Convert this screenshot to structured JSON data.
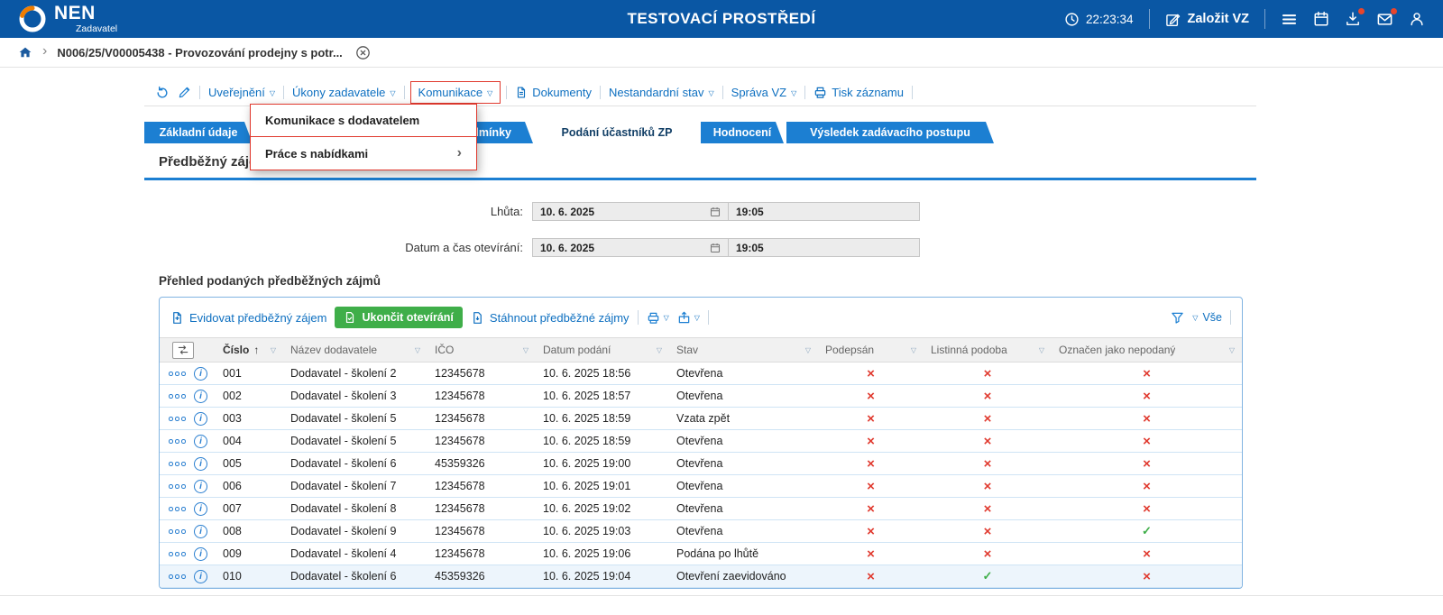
{
  "glyphs": {
    "dropdown": "▽",
    "sort_asc": "↑",
    "chevron": "›",
    "check": "✓",
    "cross": "×",
    "info": "i"
  },
  "colors": {
    "header_blue": "#0a57a4",
    "tab_blue": "#1c7fd2",
    "link_blue": "#0d6fc0",
    "green": "#3fae49",
    "red": "#e0392e",
    "orange": "#f07d00"
  },
  "header": {
    "logo": "NEN",
    "logo_sub": "Zadavatel",
    "title": "TESTOVACÍ PROSTŘEDÍ",
    "time": "22:23:34",
    "create_vz_label": "Založit VZ"
  },
  "breadcrumb": {
    "item": "N006/25/V00005438 - Provozování prodejny s potr..."
  },
  "toolbar": {
    "items": [
      {
        "label": "Uveřejnění"
      },
      {
        "label": "Úkony zadavatele"
      },
      {
        "label": "Komunikace"
      },
      {
        "label": "Dokumenty"
      },
      {
        "label": "Nestandardní stav"
      },
      {
        "label": "Správa VZ"
      },
      {
        "label": "Tisk záznamu"
      }
    ]
  },
  "menu": {
    "items": [
      {
        "label": "Komunikace s dodavatelem"
      },
      {
        "label": "Práce s nabídkami"
      }
    ]
  },
  "tabs": [
    {
      "label": "Základní údaje"
    },
    {
      "label": "Zadávací podmínky"
    },
    {
      "label": "Podání účastníků ZP"
    },
    {
      "label": "Hodnocení"
    },
    {
      "label": "Výsledek zadávacího postupu"
    }
  ],
  "section": {
    "title": "Předběžný zájem",
    "fields": [
      {
        "label": "Lhůta:",
        "date": "10. 6. 2025",
        "time": "19:05"
      },
      {
        "label": "Datum a čas otevírání:",
        "date": "10. 6. 2025",
        "time": "19:05"
      }
    ]
  },
  "table": {
    "title": "Přehled podaných předběžných zájmů",
    "sort_indicator": "↑",
    "toolbar": {
      "evidovat": "Evidovat předběžný zájem",
      "ukoncit": "Ukončit otevírání",
      "stahnout": "Stáhnout předběžné zájmy",
      "vse": "Vše"
    },
    "columns": [
      "Číslo",
      "Název dodavatele",
      "IČO",
      "Datum podání",
      "Stav",
      "Podepsán",
      "Listinná podoba",
      "Označen jako nepodaný"
    ],
    "rows": [
      {
        "cislo": "001",
        "nazev": "Dodavatel - školení 2",
        "ico": "12345678",
        "datum": "10. 6. 2025 18:56",
        "stav": "Otevřena",
        "podepsan": false,
        "listinna": false,
        "nepodany": false
      },
      {
        "cislo": "002",
        "nazev": "Dodavatel - školení 3",
        "ico": "12345678",
        "datum": "10. 6. 2025 18:57",
        "stav": "Otevřena",
        "podepsan": false,
        "listinna": false,
        "nepodany": false
      },
      {
        "cislo": "003",
        "nazev": "Dodavatel - školení 5",
        "ico": "12345678",
        "datum": "10. 6. 2025 18:59",
        "stav": "Vzata zpět",
        "podepsan": false,
        "listinna": false,
        "nepodany": false
      },
      {
        "cislo": "004",
        "nazev": "Dodavatel - školení 5",
        "ico": "12345678",
        "datum": "10. 6. 2025 18:59",
        "stav": "Otevřena",
        "podepsan": false,
        "listinna": false,
        "nepodany": false
      },
      {
        "cislo": "005",
        "nazev": "Dodavatel - školení 6",
        "ico": "45359326",
        "datum": "10. 6. 2025 19:00",
        "stav": "Otevřena",
        "podepsan": false,
        "listinna": false,
        "nepodany": false
      },
      {
        "cislo": "006",
        "nazev": "Dodavatel - školení 7",
        "ico": "12345678",
        "datum": "10. 6. 2025 19:01",
        "stav": "Otevřena",
        "podepsan": false,
        "listinna": false,
        "nepodany": false
      },
      {
        "cislo": "007",
        "nazev": "Dodavatel - školení 8",
        "ico": "12345678",
        "datum": "10. 6. 2025 19:02",
        "stav": "Otevřena",
        "podepsan": false,
        "listinna": false,
        "nepodany": false
      },
      {
        "cislo": "008",
        "nazev": "Dodavatel - školení 9",
        "ico": "12345678",
        "datum": "10. 6. 2025 19:03",
        "stav": "Otevřena",
        "podepsan": false,
        "listinna": false,
        "nepodany": true
      },
      {
        "cislo": "009",
        "nazev": "Dodavatel - školení 4",
        "ico": "12345678",
        "datum": "10. 6. 2025 19:06",
        "stav": "Podána po lhůtě",
        "podepsan": false,
        "listinna": false,
        "nepodany": false
      },
      {
        "cislo": "010",
        "nazev": "Dodavatel - školení 6",
        "ico": "45359326",
        "datum": "10. 6. 2025 19:04",
        "stav": "Otevření zaevidováno",
        "podepsan": false,
        "listinna": true,
        "nepodany": false,
        "selected": true
      }
    ]
  }
}
